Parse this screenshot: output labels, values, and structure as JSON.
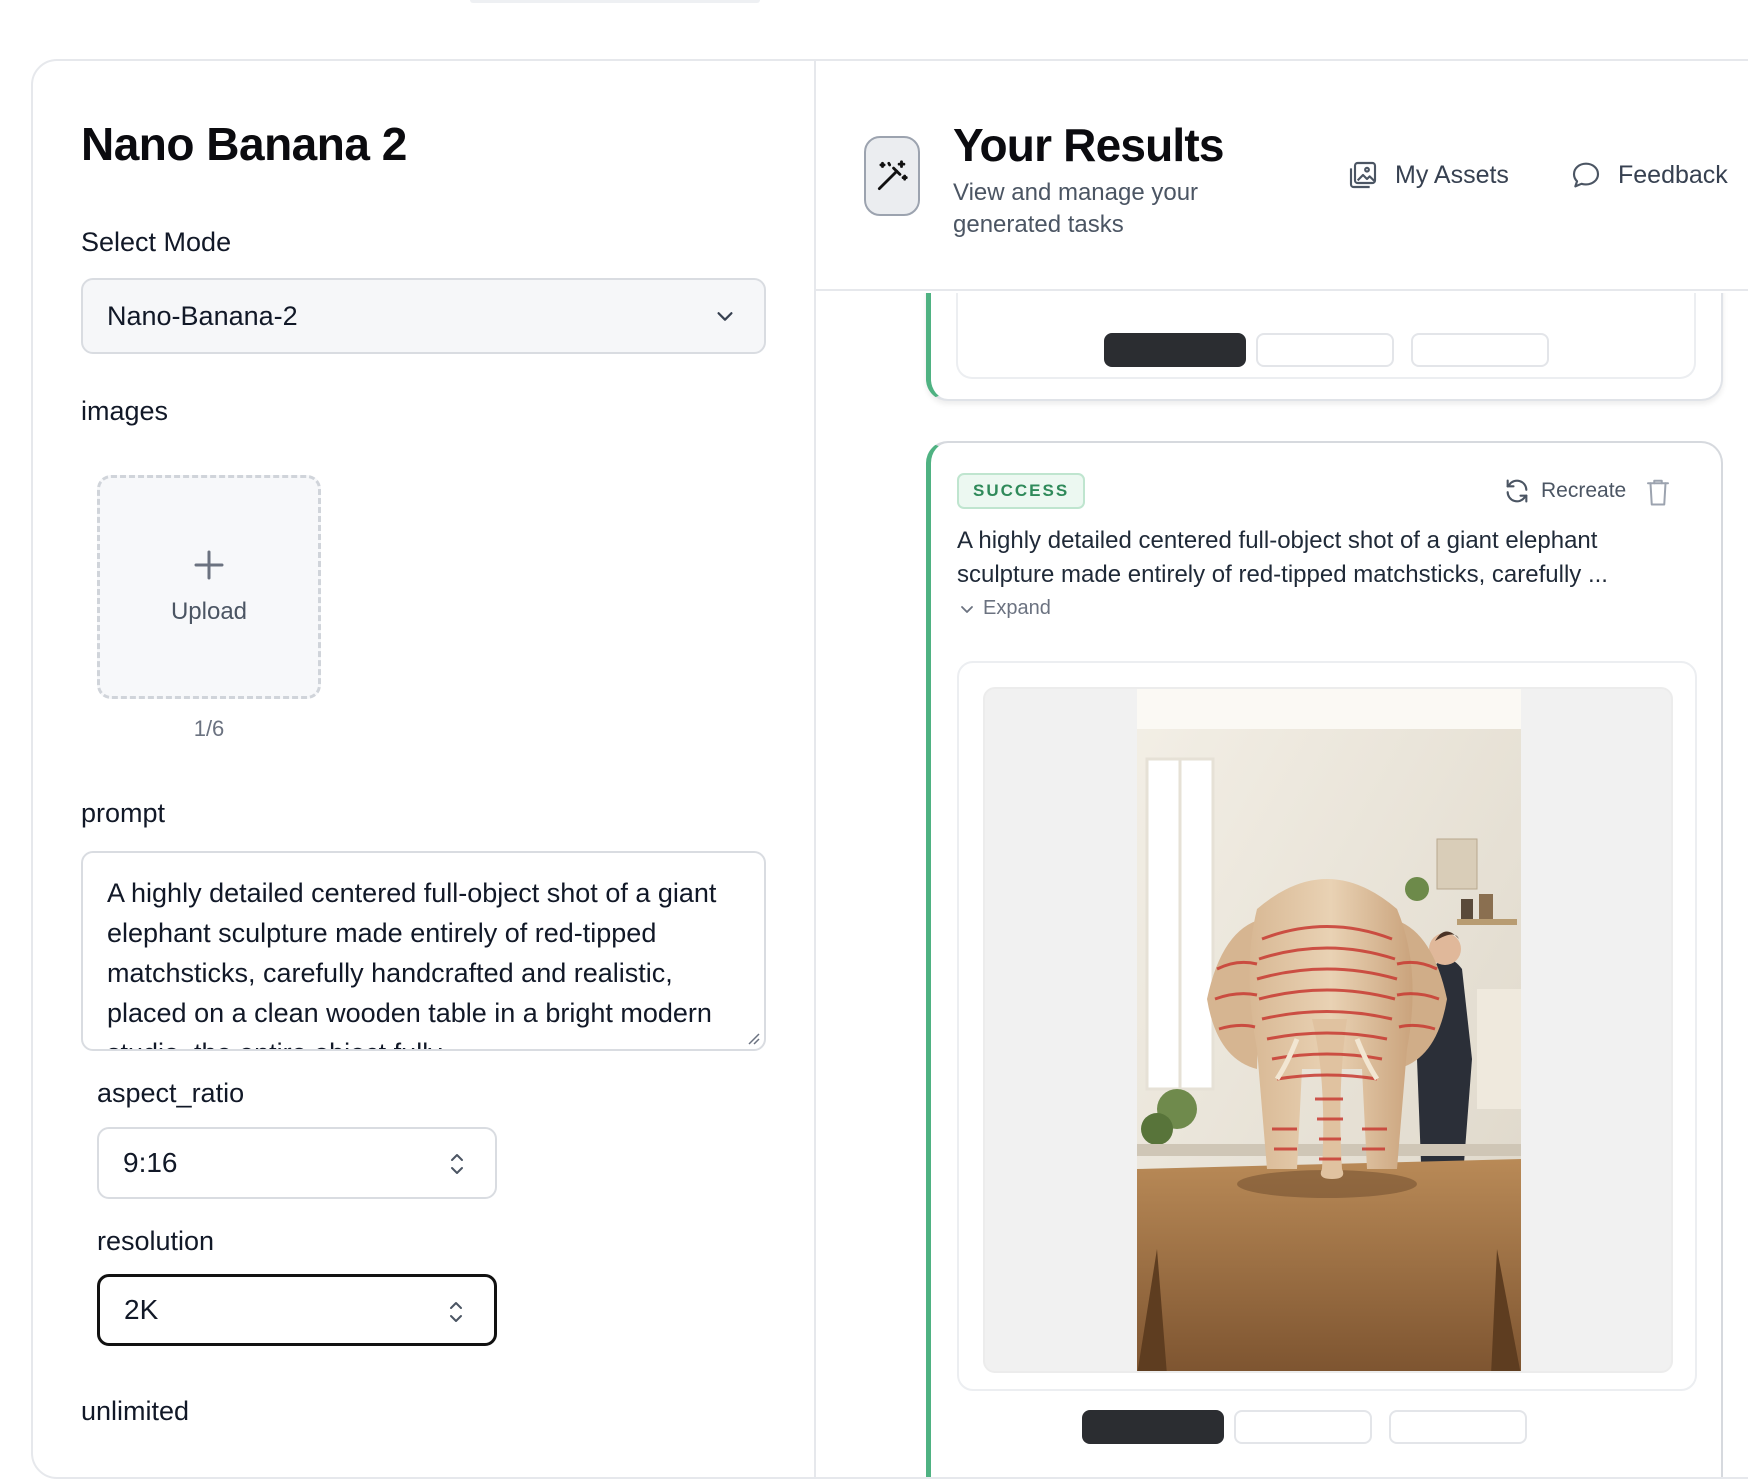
{
  "left": {
    "title": "Nano Banana 2",
    "select_mode_label": "Select Mode",
    "mode_value": "Nano-Banana-2",
    "images_label": "images",
    "upload_label": "Upload",
    "upload_count": "1/6",
    "prompt_label": "prompt",
    "prompt_value": "A highly detailed centered full-object shot of a giant elephant sculpture made entirely of red-tipped matchsticks, carefully handcrafted and realistic, placed on a clean wooden table in a bright modern studio, the entire object fully",
    "aspect_ratio_label": "aspect_ratio",
    "aspect_ratio_value": "9:16",
    "resolution_label": "resolution",
    "resolution_value": "2K",
    "unlimited_label": "unlimited"
  },
  "right": {
    "title": "Your Results",
    "subtitle": "View and manage your generated tasks",
    "my_assets": "My Assets",
    "feedback": "Feedback",
    "card": {
      "status": "SUCCESS",
      "recreate": "Recreate",
      "description": "A highly detailed centered full-object shot of a giant elephant sculpture made entirely of red-tipped matchsticks, carefully ...",
      "expand": "Expand"
    }
  },
  "colors": {
    "accent_green": "#4fb282",
    "badge_text": "#2f8a5a",
    "dark_button": "#2b2d31"
  },
  "icons": [
    "chevron-down-icon",
    "plus-icon",
    "updown-icon",
    "magic-wand-icon",
    "gallery-icon",
    "chat-bubble-icon",
    "refresh-icon",
    "trash-icon"
  ]
}
